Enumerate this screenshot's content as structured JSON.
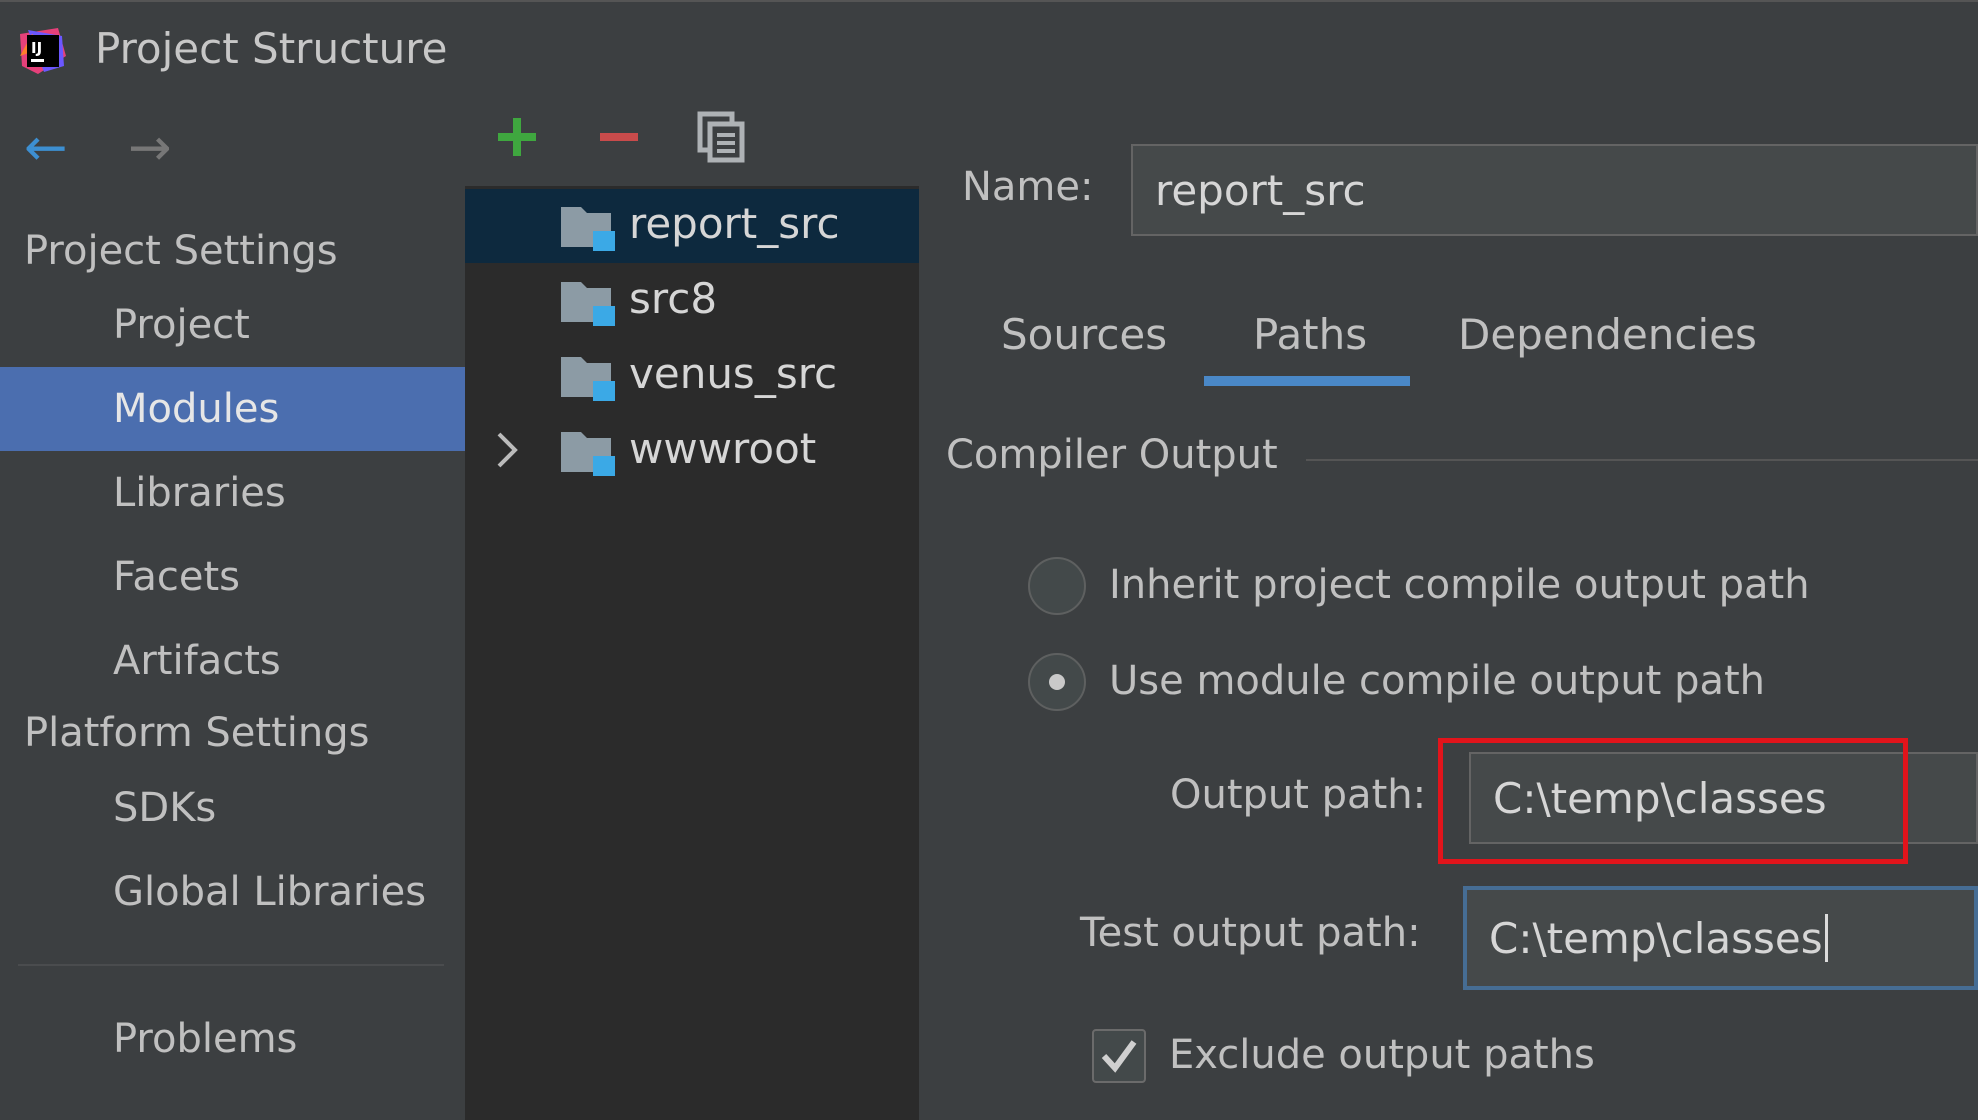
{
  "window": {
    "title": "Project Structure"
  },
  "nav": {
    "project_settings_header": "Project Settings",
    "project": "Project",
    "modules": "Modules",
    "libraries": "Libraries",
    "facets": "Facets",
    "artifacts": "Artifacts",
    "platform_settings_header": "Platform Settings",
    "sdks": "SDKs",
    "global_libraries": "Global Libraries",
    "problems": "Problems"
  },
  "toolbar": {
    "add_icon": "plus-icon",
    "remove_icon": "minus-icon",
    "copy_icon": "copy-icon"
  },
  "modules": [
    {
      "name": "report_src",
      "selected": true
    },
    {
      "name": "src8"
    },
    {
      "name": "venus_src"
    },
    {
      "name": "wwwroot",
      "expandable": true
    }
  ],
  "detail": {
    "name_label": "Name:",
    "name_value": "report_src",
    "tabs": [
      "Sources",
      "Paths",
      "Dependencies"
    ],
    "active_tab": "Paths",
    "compiler_output_header": "Compiler Output",
    "inherit_option": "Inherit project compile output path",
    "use_module_option": "Use module compile output path",
    "selected_option": "Use module compile output path",
    "output_path_label": "Output path:",
    "output_path_value": "C:\\temp\\classes",
    "test_output_path_label": "Test output path:",
    "test_output_path_value": "C:\\temp\\classes",
    "exclude_label": "Exclude output paths",
    "exclude_checked": true
  },
  "colors": {
    "selection": "#4b6eaf",
    "tab_underline": "#4a88c7",
    "highlight_box": "#e2141b",
    "add_green": "#3fa73f",
    "remove_red": "#c94b4b",
    "folder_badge": "#3ba9e6"
  }
}
